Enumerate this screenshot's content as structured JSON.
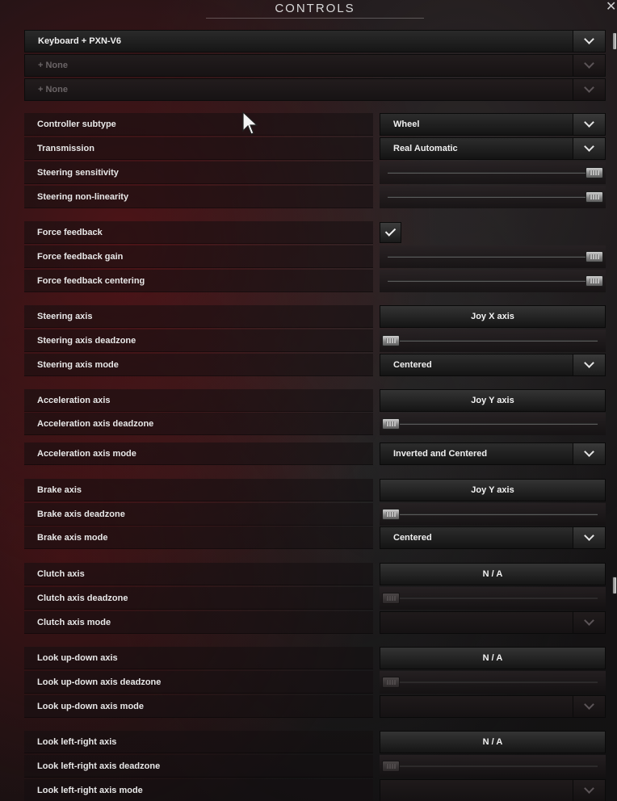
{
  "window": {
    "title": "CONTROLS",
    "close_label": "✕"
  },
  "devices": [
    {
      "label": "Keyboard + PXN-V6",
      "enabled": true
    },
    {
      "label": "+ None",
      "enabled": false
    },
    {
      "label": "+ None",
      "enabled": false
    }
  ],
  "settings": {
    "controller_subtype": {
      "label": "Controller subtype",
      "value": "Wheel"
    },
    "transmission": {
      "label": "Transmission",
      "value": "Real Automatic"
    },
    "steering_sensitivity": {
      "label": "Steering sensitivity",
      "level": 1.0
    },
    "steering_non_linearity": {
      "label": "Steering non-linearity",
      "level": 1.0
    },
    "force_feedback": {
      "label": "Force feedback",
      "checked": true
    },
    "force_feedback_gain": {
      "label": "Force feedback gain",
      "level": 1.0
    },
    "force_feedback_centering": {
      "label": "Force feedback centering",
      "level": 1.0
    },
    "steering_axis": {
      "label": "Steering axis",
      "value": "Joy X axis"
    },
    "steering_axis_deadzone": {
      "label": "Steering axis deadzone",
      "level": 0.0
    },
    "steering_axis_mode": {
      "label": "Steering axis mode",
      "value": "Centered"
    },
    "acceleration_axis": {
      "label": "Acceleration axis",
      "value": "Joy Y axis"
    },
    "acceleration_axis_deadzone": {
      "label": "Acceleration axis deadzone",
      "level": 0.0
    },
    "acceleration_axis_mode": {
      "label": "Acceleration axis mode",
      "value": "Inverted and Centered"
    },
    "brake_axis": {
      "label": "Brake axis",
      "value": "Joy Y axis"
    },
    "brake_axis_deadzone": {
      "label": "Brake axis deadzone",
      "level": 0.0
    },
    "brake_axis_mode": {
      "label": "Brake axis mode",
      "value": "Centered"
    },
    "clutch_axis": {
      "label": "Clutch axis",
      "value": "N / A"
    },
    "clutch_axis_deadzone": {
      "label": "Clutch axis deadzone",
      "level": 0.0
    },
    "clutch_axis_mode": {
      "label": "Clutch axis mode",
      "value": ""
    },
    "look_up_down_axis": {
      "label": "Look up-down axis",
      "value": "N / A"
    },
    "look_up_down_axis_deadzone": {
      "label": "Look up-down axis deadzone",
      "level": 0.0
    },
    "look_up_down_axis_mode": {
      "label": "Look up-down axis mode",
      "value": ""
    },
    "look_left_right_axis": {
      "label": "Look left-right axis",
      "value": "N / A"
    },
    "look_left_right_axis_deadzone": {
      "label": "Look left-right axis deadzone",
      "level": 0.0
    },
    "look_left_right_axis_mode": {
      "label": "Look left-right axis mode",
      "value": ""
    }
  },
  "icons": {
    "dropdown": "chevron-down-icon",
    "check": "checkmark-icon",
    "close": "close-icon",
    "cursor": "mouse-pointer-icon"
  }
}
